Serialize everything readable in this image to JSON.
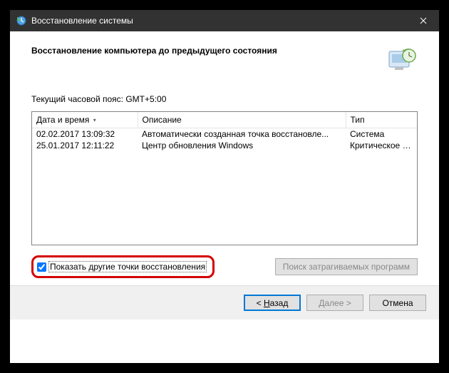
{
  "window": {
    "title": "Восстановление системы"
  },
  "heading": "Восстановление компьютера до предыдущего состояния",
  "timezone_label": "Текущий часовой пояс: GMT+5:00",
  "columns": {
    "datetime": "Дата и время",
    "description": "Описание",
    "type": "Тип"
  },
  "rows": [
    {
      "datetime": "02.02.2017 13:09:32",
      "description": "Автоматически созданная точка восстановле...",
      "type": "Система"
    },
    {
      "datetime": "25.01.2017 12:11:22",
      "description": "Центр обновления Windows",
      "type": "Критическое о..."
    }
  ],
  "checkbox": {
    "label": "Показать другие точки восстановления",
    "checked": true
  },
  "scan_button": "Поиск затрагиваемых программ",
  "buttons": {
    "back_prefix": "< ",
    "back_u": "Н",
    "back_suffix": "азад",
    "next_prefix": "",
    "next_u": "Д",
    "next_suffix": "алее >",
    "cancel": "Отмена"
  }
}
